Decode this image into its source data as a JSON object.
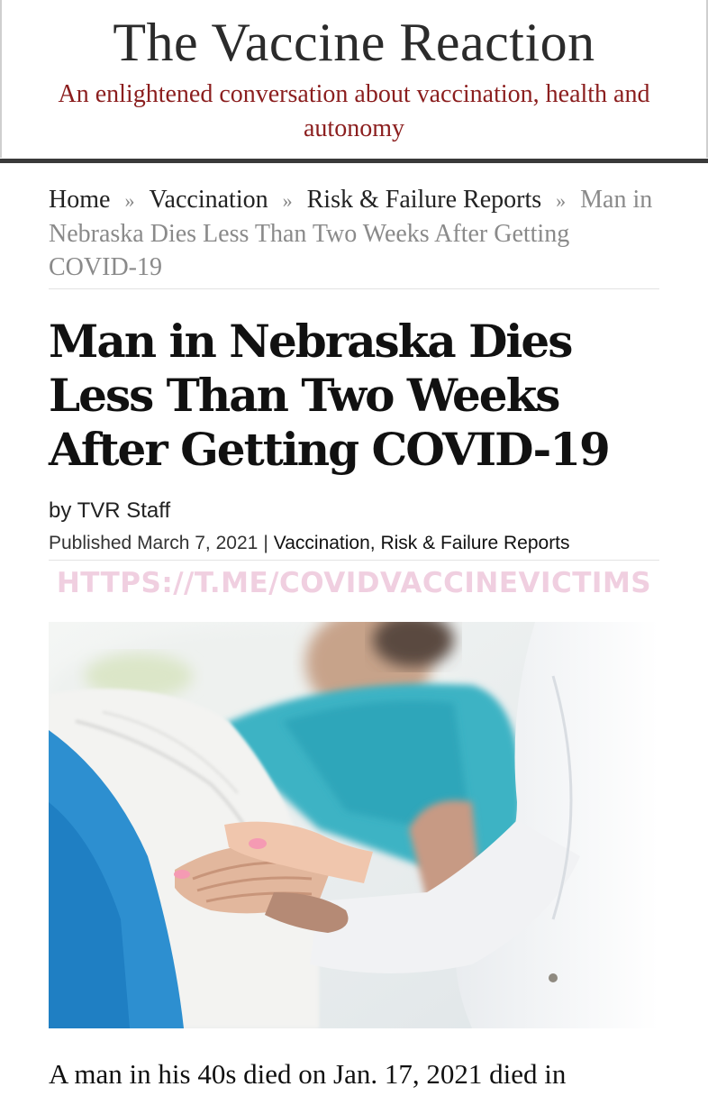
{
  "site": {
    "title": "The Vaccine Reaction",
    "tagline": "An enlightened conversation about vaccination, health and autonomy"
  },
  "breadcrumb": {
    "items": [
      "Home",
      "Vaccination",
      "Risk & Failure Reports"
    ],
    "separator": "»",
    "current": "Man in Nebraska Dies Less Than Two Weeks After Getting COVID-19"
  },
  "article": {
    "title": "Man in Nebraska Dies Less Than Two Weeks After Getting COVID-19",
    "byline": "by TVR Staff",
    "published_label": "Published March 7, 2021",
    "meta_separator": "|",
    "categories": "Vaccination, Risk & Failure Reports",
    "watermark": "HTTPS://T.ME/COVIDVACCINEVICTIMS",
    "image_icon": "hospital-patient-photo",
    "body_first_line": "A man in his 40s died on Jan. 17, 2021 died in"
  },
  "colors": {
    "tagline": "#8b1e1e",
    "watermark": "#f0cfe0",
    "header_rule": "#3a3a3a"
  }
}
